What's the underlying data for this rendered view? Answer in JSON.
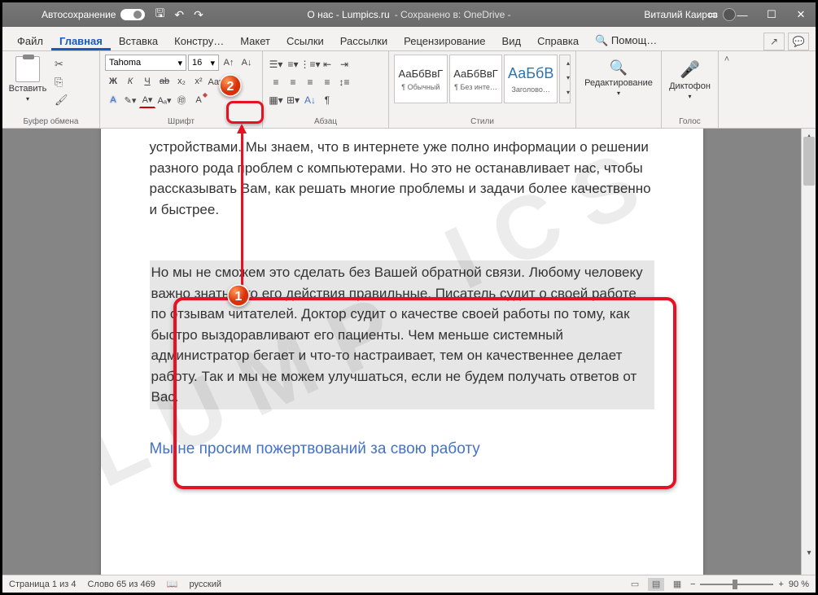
{
  "titlebar": {
    "autosave": "Автосохранение",
    "doc_name": "О нас - Lumpics.ru",
    "saved": "- Сохранено в: OneDrive -",
    "user": "Виталий Каиров"
  },
  "tabs": {
    "file": "Файл",
    "home": "Главная",
    "insert": "Вставка",
    "design": "Констру…",
    "layout": "Макет",
    "refs": "Ссылки",
    "mail": "Рассылки",
    "review": "Рецензирование",
    "view": "Вид",
    "help": "Справка",
    "search": "Помощ…"
  },
  "ribbon": {
    "paste": "Вставить",
    "clipboard": "Буфер обмена",
    "font_name": "Tahoma",
    "font_size": "16",
    "font_group": "Шрифт",
    "para_group": "Абзац",
    "styles_group": "Стили",
    "edit_group": "Редактирование",
    "voice_group": "Голос",
    "dictate": "Диктофон",
    "style_sample": "АаБбВвГ",
    "style_sample_h": "АаБбВ",
    "style1": "¶ Обычный",
    "style2": "¶ Без инте…",
    "style3": "Заголово…"
  },
  "doc": {
    "p1": "устройствами. Мы знаем, что в интернете уже полно информации о решении разного рода проблем с компьютерами. Но это не останавливает нас, чтобы рассказывать Вам, как решать многие проблемы и задачи более качественно и быстрее.",
    "p2": "Но мы не сможем это сделать без Вашей обратной связи. Любому человеку важно знать, что его действия правильные. Писатель судит о своей работе по отзывам читателей. Доктор судит о качестве своей работы по тому, как быстро выздоравливают его пациенты. Чем меньше системный администратор бегает и что-то настраивает, тем он качественнее делает работу. Так и мы не можем улучшаться, если не будем получать ответов от Вас.",
    "h1": "Мы не просим пожертвований за свою работу"
  },
  "status": {
    "page": "Страница 1 из 4",
    "words": "Слово 65 из 469",
    "lang": "русский",
    "zoom": "90 %"
  }
}
